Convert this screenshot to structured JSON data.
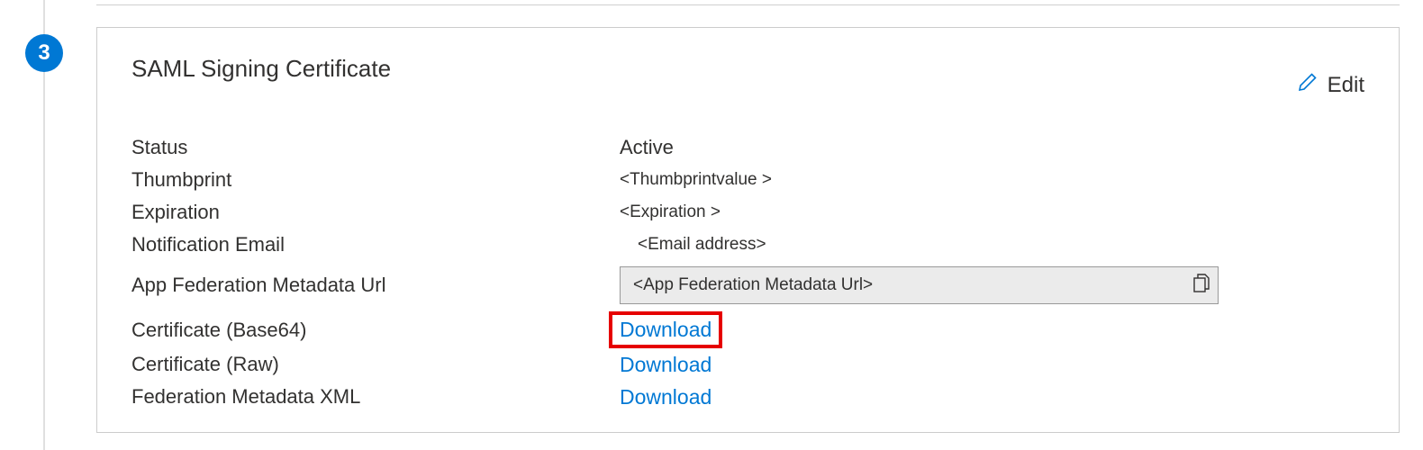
{
  "step": {
    "number": "3"
  },
  "card": {
    "title": "SAML Signing Certificate",
    "edit_label": "Edit"
  },
  "fields": {
    "status": {
      "label": "Status",
      "value": "Active"
    },
    "thumbprint": {
      "label": "Thumbprint",
      "value": "<Thumbprintvalue >"
    },
    "expiration": {
      "label": "Expiration",
      "value": "<Expiration >"
    },
    "notification_email": {
      "label": "Notification Email",
      "value": "<Email address>"
    },
    "metadata_url": {
      "label": "App Federation Metadata Url",
      "value": "<App Federation Metadata Url>"
    },
    "cert_base64": {
      "label": "Certificate (Base64)",
      "link": "Download"
    },
    "cert_raw": {
      "label": "Certificate (Raw)",
      "link": "Download"
    },
    "fed_metadata_xml": {
      "label": "Federation Metadata XML",
      "link": "Download"
    }
  }
}
